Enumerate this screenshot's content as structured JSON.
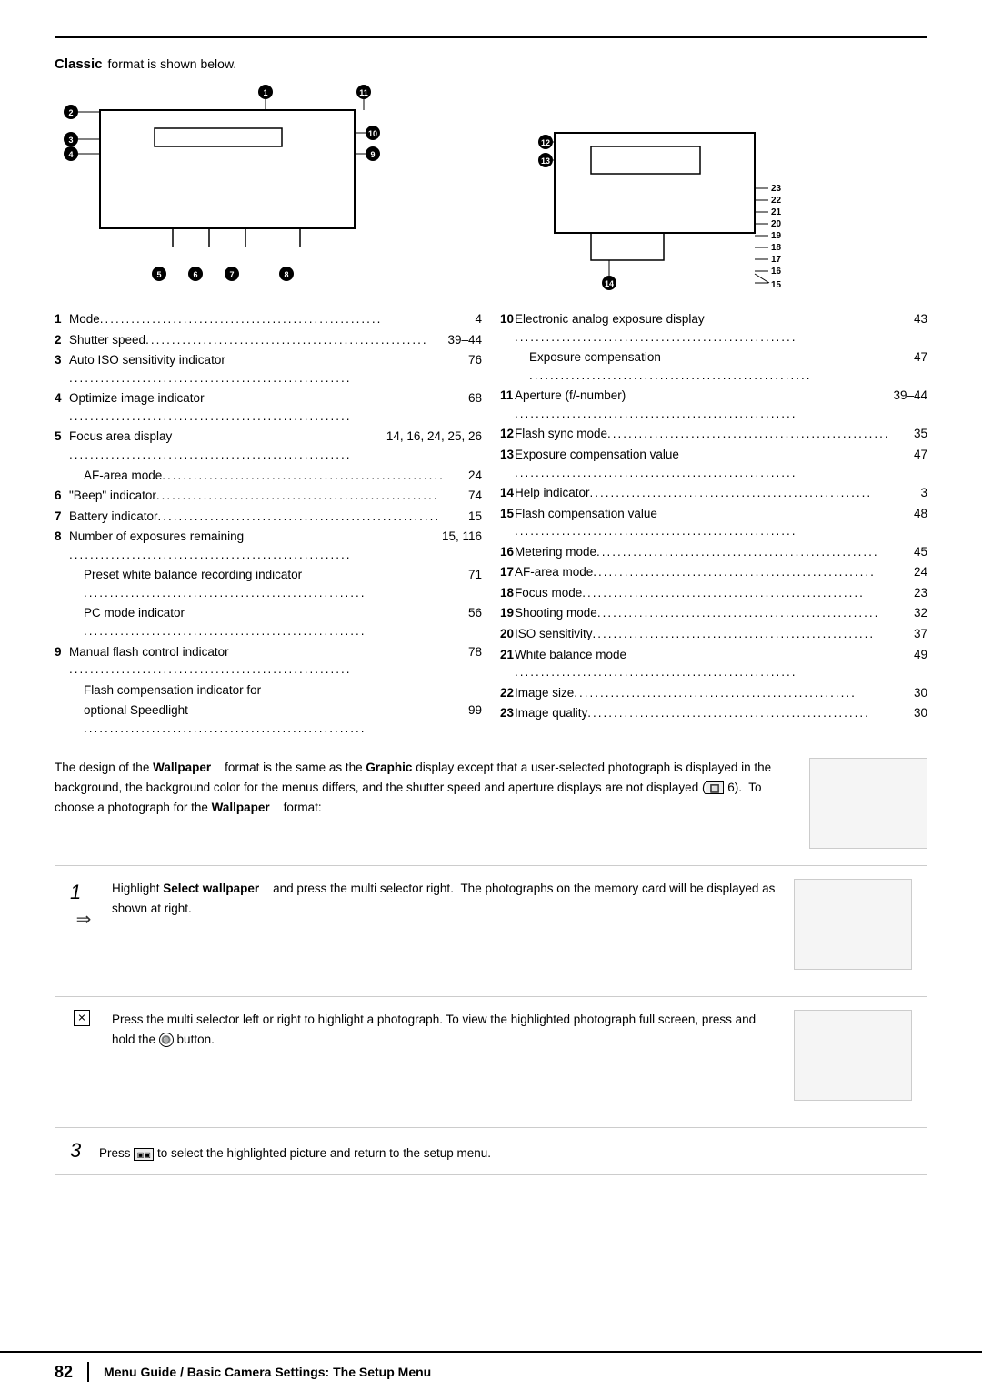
{
  "page": {
    "top_border": true,
    "classic_label": "Classic",
    "classic_suffix": "  format is shown below.",
    "description": {
      "text": "The design of the Wallpaper format is the same as the Graphic display except that a user-selected photograph is displayed in the background, the background color for the menus differs, and the shutter speed and aperture displays are not displayed (  6).  To choose a photograph for the Wallpaper    format:",
      "wallpaper_bold1": "Wallpaper",
      "graphic_bold": "Graphic",
      "wallpaper_bold2": "Wallpaper"
    },
    "steps": [
      {
        "number": "1",
        "icon_type": "arrow",
        "text": "Highlight Select wallpaper    and press the multi selector right.  The photographs on the memory card will be displayed as shown at right.",
        "select_wallpaper_bold": "Select wallpaper",
        "has_image": true
      },
      {
        "number": null,
        "icon_type": "checkbox",
        "text": "Press the multi selector left or right to highlight a photograph. To view the highlighted photograph full screen, press and hold the   button.",
        "has_image": true
      },
      {
        "number": "3",
        "icon_type": null,
        "text": "Press   to select the highlighted picture and return to the setup menu.",
        "has_image": false
      }
    ],
    "list_left": [
      {
        "num": "1",
        "desc": "Mode",
        "dots": true,
        "page": "4"
      },
      {
        "num": "2",
        "desc": "Shutter speed",
        "dots": true,
        "page": "39–44"
      },
      {
        "num": "3",
        "desc": "Auto ISO sensitivity indicator",
        "dots": true,
        "page": "76"
      },
      {
        "num": "4",
        "desc": "Optimize image indicator",
        "dots": true,
        "page": "68"
      },
      {
        "num": "5",
        "desc": "Focus area display",
        "dots": true,
        "page": "14, 16, 24, 25, 26"
      },
      {
        "num": null,
        "desc": "AF-area mode",
        "dots": true,
        "page": "24",
        "indent": true
      },
      {
        "num": "6",
        "desc": "\"Beep\" indicator",
        "dots": true,
        "page": "74"
      },
      {
        "num": "7",
        "desc": "Battery indicator",
        "dots": true,
        "page": "15"
      },
      {
        "num": "8",
        "desc": "Number of exposures remaining",
        "dots": true,
        "page": "15, 116"
      },
      {
        "num": null,
        "desc": "Preset white balance recording indicator",
        "dots": true,
        "page": "71",
        "indent": true
      },
      {
        "num": null,
        "desc": "PC mode indicator",
        "dots": true,
        "page": "56",
        "indent": true
      },
      {
        "num": "9",
        "desc": "Manual flash control indicator",
        "dots": true,
        "page": "78"
      },
      {
        "num": null,
        "desc": "Flash compensation indicator for",
        "dots": false,
        "page": "",
        "indent": true
      },
      {
        "num": null,
        "desc": "optional Speedlight",
        "dots": true,
        "page": "99",
        "indent": true
      }
    ],
    "list_right": [
      {
        "num": "10",
        "desc": "Electronic analog exposure display",
        "dots": true,
        "page": "43"
      },
      {
        "num": null,
        "desc": "Exposure compensation",
        "dots": true,
        "page": "47",
        "indent": true
      },
      {
        "num": "11",
        "desc": "Aperture (f/-number)",
        "dots": true,
        "page": "39–44"
      },
      {
        "num": "12",
        "desc": "Flash sync mode",
        "dots": true,
        "page": "35"
      },
      {
        "num": "13",
        "desc": "Exposure compensation value",
        "dots": true,
        "page": "47"
      },
      {
        "num": "14",
        "desc": "Help indicator",
        "dots": true,
        "page": "3"
      },
      {
        "num": "15",
        "desc": "Flash compensation value",
        "dots": true,
        "page": "48"
      },
      {
        "num": "16",
        "desc": "Metering mode",
        "dots": true,
        "page": "45"
      },
      {
        "num": "17",
        "desc": "AF-area mode",
        "dots": true,
        "page": "24"
      },
      {
        "num": "18",
        "desc": "Focus mode",
        "dots": true,
        "page": "23"
      },
      {
        "num": "19",
        "desc": "Shooting mode",
        "dots": true,
        "page": "32"
      },
      {
        "num": "20",
        "desc": "ISO sensitivity",
        "dots": true,
        "page": "37"
      },
      {
        "num": "21",
        "desc": "White balance mode",
        "dots": true,
        "page": "49"
      },
      {
        "num": "22",
        "desc": "Image size",
        "dots": true,
        "page": "30"
      },
      {
        "num": "23",
        "desc": "Image quality",
        "dots": true,
        "page": "30"
      }
    ],
    "footer": {
      "page_number": "82",
      "title": "Menu Guide / Basic Camera Settings: The Setup Menu"
    }
  }
}
